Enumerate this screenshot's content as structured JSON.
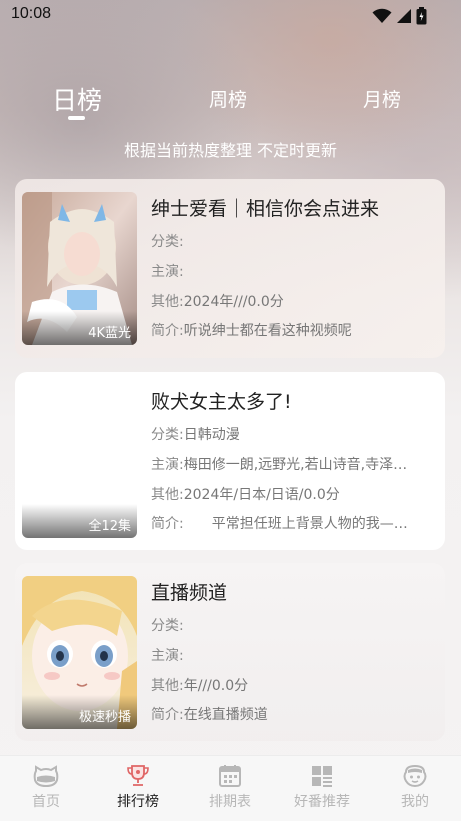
{
  "status_bar": {
    "time": "10:08"
  },
  "tabs": {
    "day": "日榜",
    "week": "周榜",
    "month": "月榜",
    "active": "day"
  },
  "subtitle": "根据当前热度整理 不定时更新",
  "labels": {
    "category": "分类:",
    "cast": "主演:",
    "other": "其他:",
    "intro": "简介:"
  },
  "cards": [
    {
      "title": "绅士爱看｜相信你会点进来",
      "badge": "4K蓝光",
      "category": "",
      "cast": "",
      "other": "2024年///0.0分",
      "intro": "听说绅士都在看这种视频呢"
    },
    {
      "title": "败犬女主太多了!",
      "badge": "全12集",
      "category": "日韩动漫",
      "cast": "梅田修一朗,远野光,若山诗音,寺泽…",
      "other": "2024年/日本/日语/0.0分",
      "intro": "　　平常担任班上背景人物的我—…"
    },
    {
      "title": "直播频道",
      "badge": "极速秒播",
      "category": "",
      "cast": "",
      "other": "年///0.0分",
      "intro": "在线直播频道"
    }
  ],
  "bottom_nav": [
    {
      "label": "首页",
      "icon": "home-icon"
    },
    {
      "label": "排行榜",
      "icon": "trophy-icon"
    },
    {
      "label": "排期表",
      "icon": "calendar-icon"
    },
    {
      "label": "好番推荐",
      "icon": "grid-icon"
    },
    {
      "label": "我的",
      "icon": "profile-icon"
    }
  ],
  "colors": {
    "active_text": "#222222",
    "inactive_text": "#b7b7b7",
    "accent": "#e06666"
  }
}
